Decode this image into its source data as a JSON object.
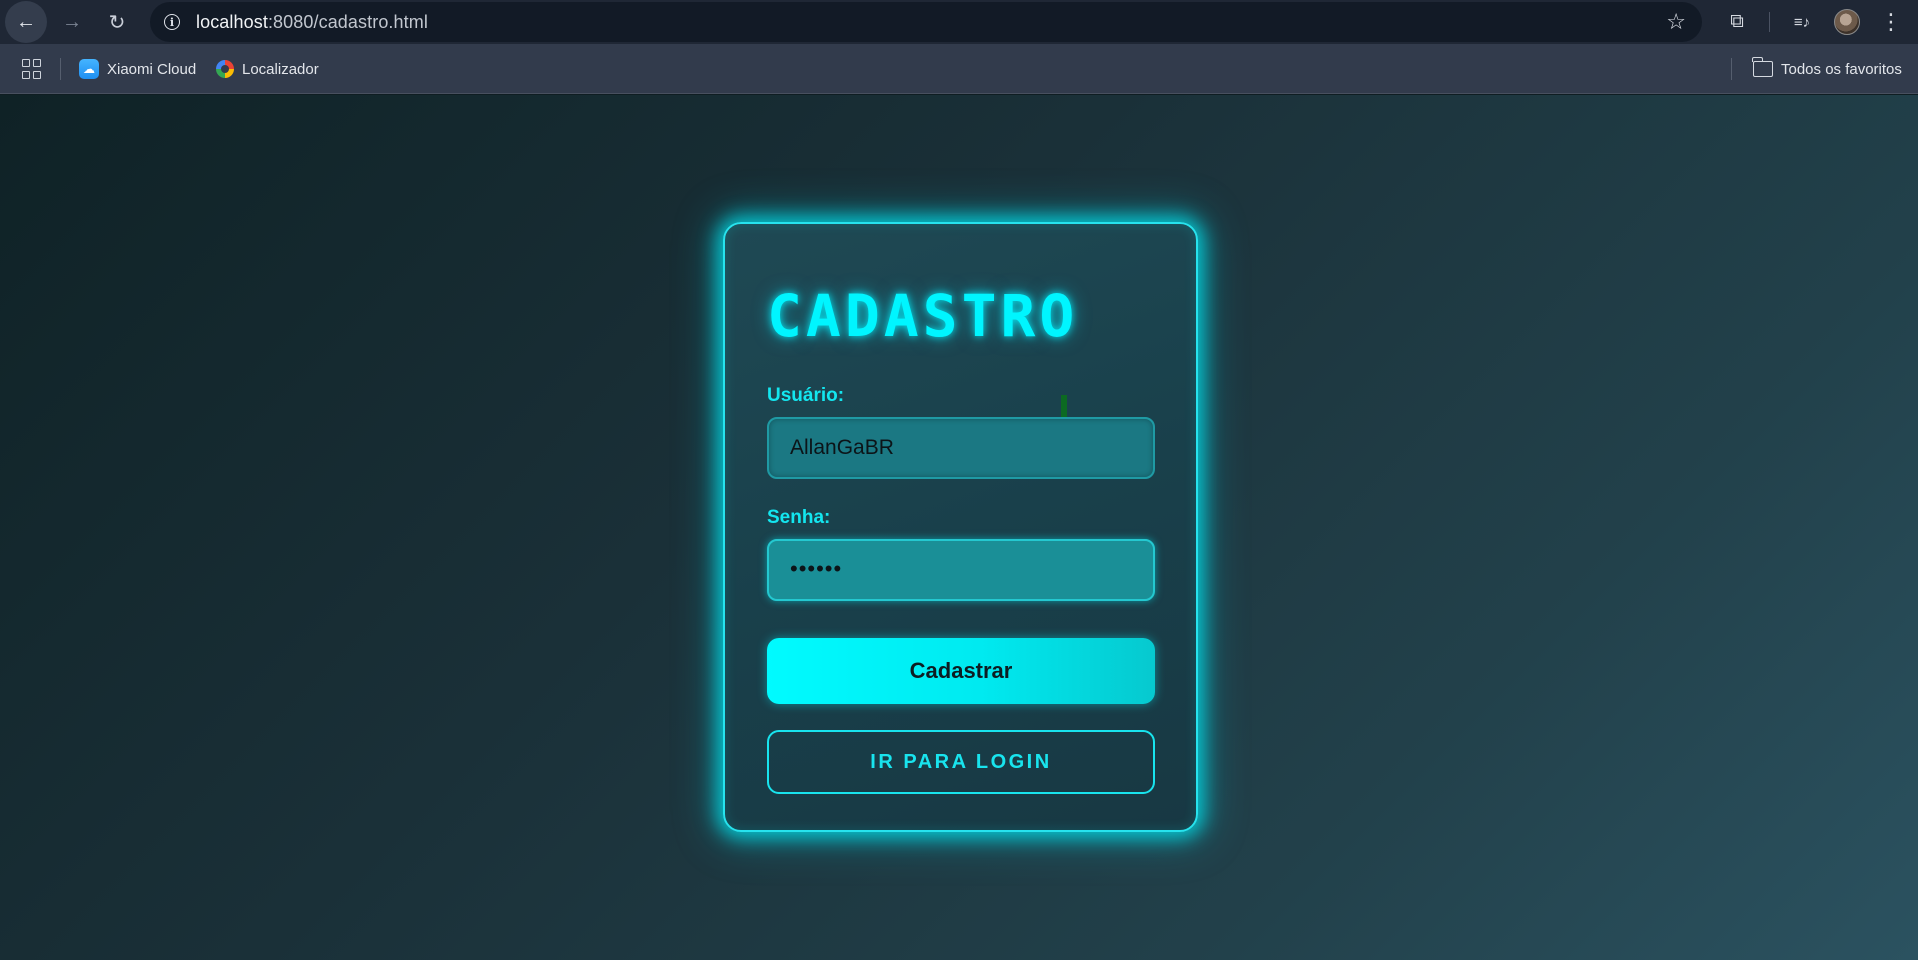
{
  "browser": {
    "url_host": "localhost",
    "url_path": ":8080/cadastro.html",
    "icons": [
      "back-icon",
      "forward-icon",
      "reload-icon",
      "info-icon",
      "star-icon",
      "extensions-icon",
      "media-icon",
      "avatar",
      "menu-icon"
    ],
    "back_glyph": "←",
    "forward_glyph": "→",
    "reload_glyph": "↻",
    "star_glyph": "☆",
    "extensions_glyph": "⧉",
    "media_glyph": "≡♪",
    "menu_glyph": "⋮",
    "info_glyph": "i"
  },
  "bookmarks": {
    "items": [
      {
        "label": "Xiaomi Cloud",
        "icon": "cloud-icon"
      },
      {
        "label": "Localizador",
        "icon": "locator-icon"
      }
    ],
    "all_favorites": "Todos os favoritos"
  },
  "form": {
    "title": "CADASTRO",
    "username_label": "Usuário:",
    "username_value": "AllanGaBR",
    "password_label": "Senha:",
    "password_value": "••••••",
    "submit_label": "Cadastrar",
    "login_link_label": "IR PARA LOGIN"
  },
  "colors": {
    "accent": "#00f5ff",
    "card_bg": "#1b424d",
    "page_bg_start": "#0f2226",
    "page_bg_end": "#2b5260"
  }
}
